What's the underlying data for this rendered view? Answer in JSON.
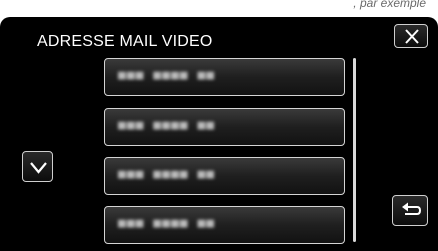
{
  "top_strip": {
    "text": ", par exemple"
  },
  "screen": {
    "title": "ADRESSE MAIL VIDEO"
  },
  "addresses": [
    {
      "value": "■■■ ■■■■ ■■"
    },
    {
      "value": "■■■ ■■■■ ■■"
    },
    {
      "value": "■■■ ■■■■ ■■"
    },
    {
      "value": "■■■ ■■■■ ■■"
    }
  ],
  "icons": {
    "close": "close-icon",
    "scroll_down": "chevron-down-icon",
    "back": "return-arrow-icon"
  },
  "colors": {
    "screen_background": "#000000",
    "button_border": "#cfcfcf",
    "text": "#ffffff"
  }
}
